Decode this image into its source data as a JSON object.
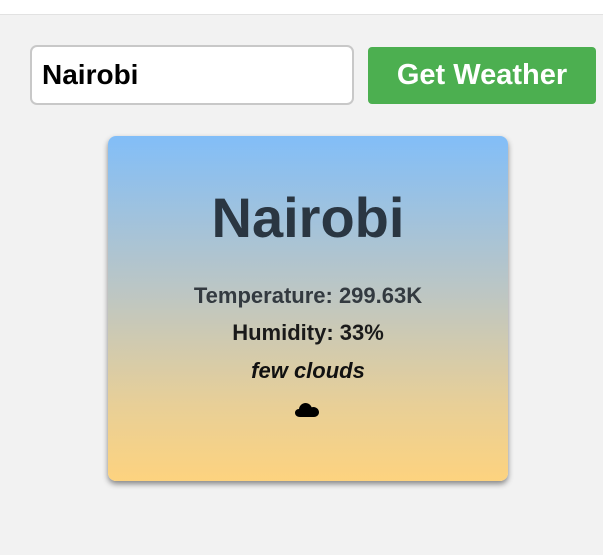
{
  "search": {
    "value": "Nairobi"
  },
  "button": {
    "label": "Get Weather"
  },
  "weather": {
    "city": "Nairobi",
    "temperature_text": "Temperature: 299.63K",
    "humidity_text": "Humidity: 33%",
    "description": "few clouds",
    "icon": "cloud-icon"
  },
  "colors": {
    "button_bg": "#4caf50",
    "card_gradient_top": "#82bef8",
    "card_gradient_bottom": "#fdd37f",
    "city_text": "#2a3642"
  }
}
